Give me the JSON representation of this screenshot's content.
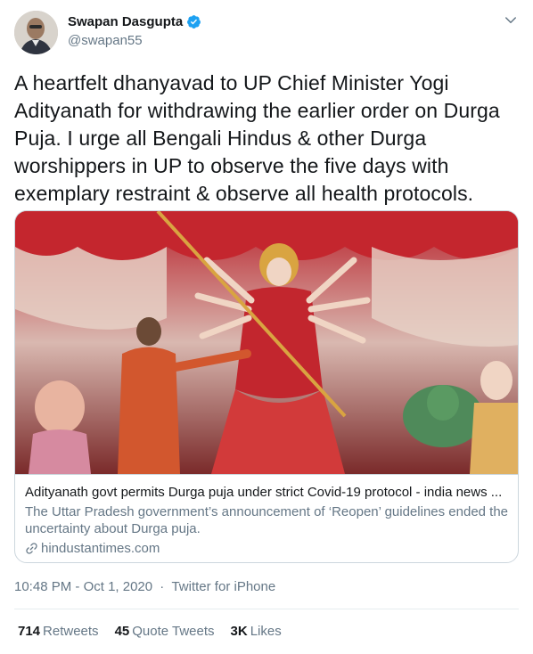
{
  "author": {
    "name": "Swapan Dasgupta",
    "handle": "@swapan55",
    "verified_icon": "verified-badge-icon"
  },
  "tweet": {
    "text": "A heartfelt dhanyavad to UP Chief Minister Yogi Adityanath for withdrawing the earlier order on Durga Puja. I urge all Bengali Hindus & other Durga worshippers in UP to observe the five days with exemplary restraint & observe all health protocols."
  },
  "card": {
    "title": "Adityanath govt permits Durga puja under strict Covid-19 protocol - india news ...",
    "description": "The Uttar Pradesh government’s announcement of ‘Reopen’ guidelines ended the uncertainty about Durga puja.",
    "domain": "hindustantimes.com"
  },
  "meta": {
    "time": "10:48 PM",
    "date": "Oct 1, 2020",
    "separator": "·",
    "source": "Twitter for iPhone"
  },
  "stats": {
    "retweets_count": "714",
    "retweets_label": "Retweets",
    "quotes_count": "45",
    "quotes_label": "Quote Tweets",
    "likes_count": "3K",
    "likes_label": "Likes"
  },
  "colors": {
    "verified": "#1da1f2",
    "secondary_text": "#657786",
    "border": "#ccd6dd"
  }
}
